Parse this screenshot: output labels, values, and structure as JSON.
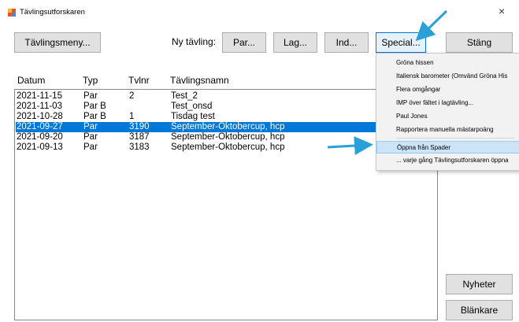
{
  "window": {
    "title": "Tävlingsutforskaren",
    "close_glyph": "×"
  },
  "toolbar": {
    "menu_button": "Tävlingsmeny...",
    "ny_label": "Ny tävling:",
    "par_button": "Par...",
    "lag_button": "Lag...",
    "ind_button": "Ind...",
    "special_button": "Special...",
    "close_button": "Stäng"
  },
  "table": {
    "headers": {
      "datum": "Datum",
      "typ": "Typ",
      "tvlnr": "Tvlnr",
      "namn": "Tävlingsnamn"
    },
    "rows": [
      {
        "datum": "2021-11-15",
        "typ": "Par",
        "tvlnr": "2",
        "namn": "Test_2"
      },
      {
        "datum": "2021-11-03",
        "typ": "Par B",
        "tvlnr": "",
        "namn": "Test_onsd"
      },
      {
        "datum": "2021-10-28",
        "typ": "Par B",
        "tvlnr": "1",
        "namn": "Tisdag test"
      },
      {
        "datum": "2021-09-27",
        "typ": "Par",
        "tvlnr": "3190",
        "namn": "September-Oktobercup, hcp"
      },
      {
        "datum": "2021-09-20",
        "typ": "Par",
        "tvlnr": "3187",
        "namn": "September-Oktobercup, hcp"
      },
      {
        "datum": "2021-09-13",
        "typ": "Par",
        "tvlnr": "3183",
        "namn": "September-Oktobercup, hcp"
      }
    ],
    "selected_index": 3
  },
  "special_menu": {
    "items": [
      "Gröna hissen",
      "Italiensk barometer (Omvänd Gröna His",
      "Flera omgångar",
      "IMP över fältet i lagtävling...",
      "Paul Jones",
      "Rapportera manuella mästarpoäng",
      "Öppna från Spader",
      "... varje gång Tävlingsutforskaren öppna"
    ],
    "highlighted_index": 6
  },
  "side_buttons": {
    "nyheter": "Nyheter",
    "blankare": "Blänkare"
  },
  "colors": {
    "selection": "#0078d7",
    "annotation_arrow": "#2a9fd8",
    "menu_highlight": "#cce4f7"
  },
  "icons": {
    "app": "app-logo-icon",
    "close": "close-icon"
  }
}
